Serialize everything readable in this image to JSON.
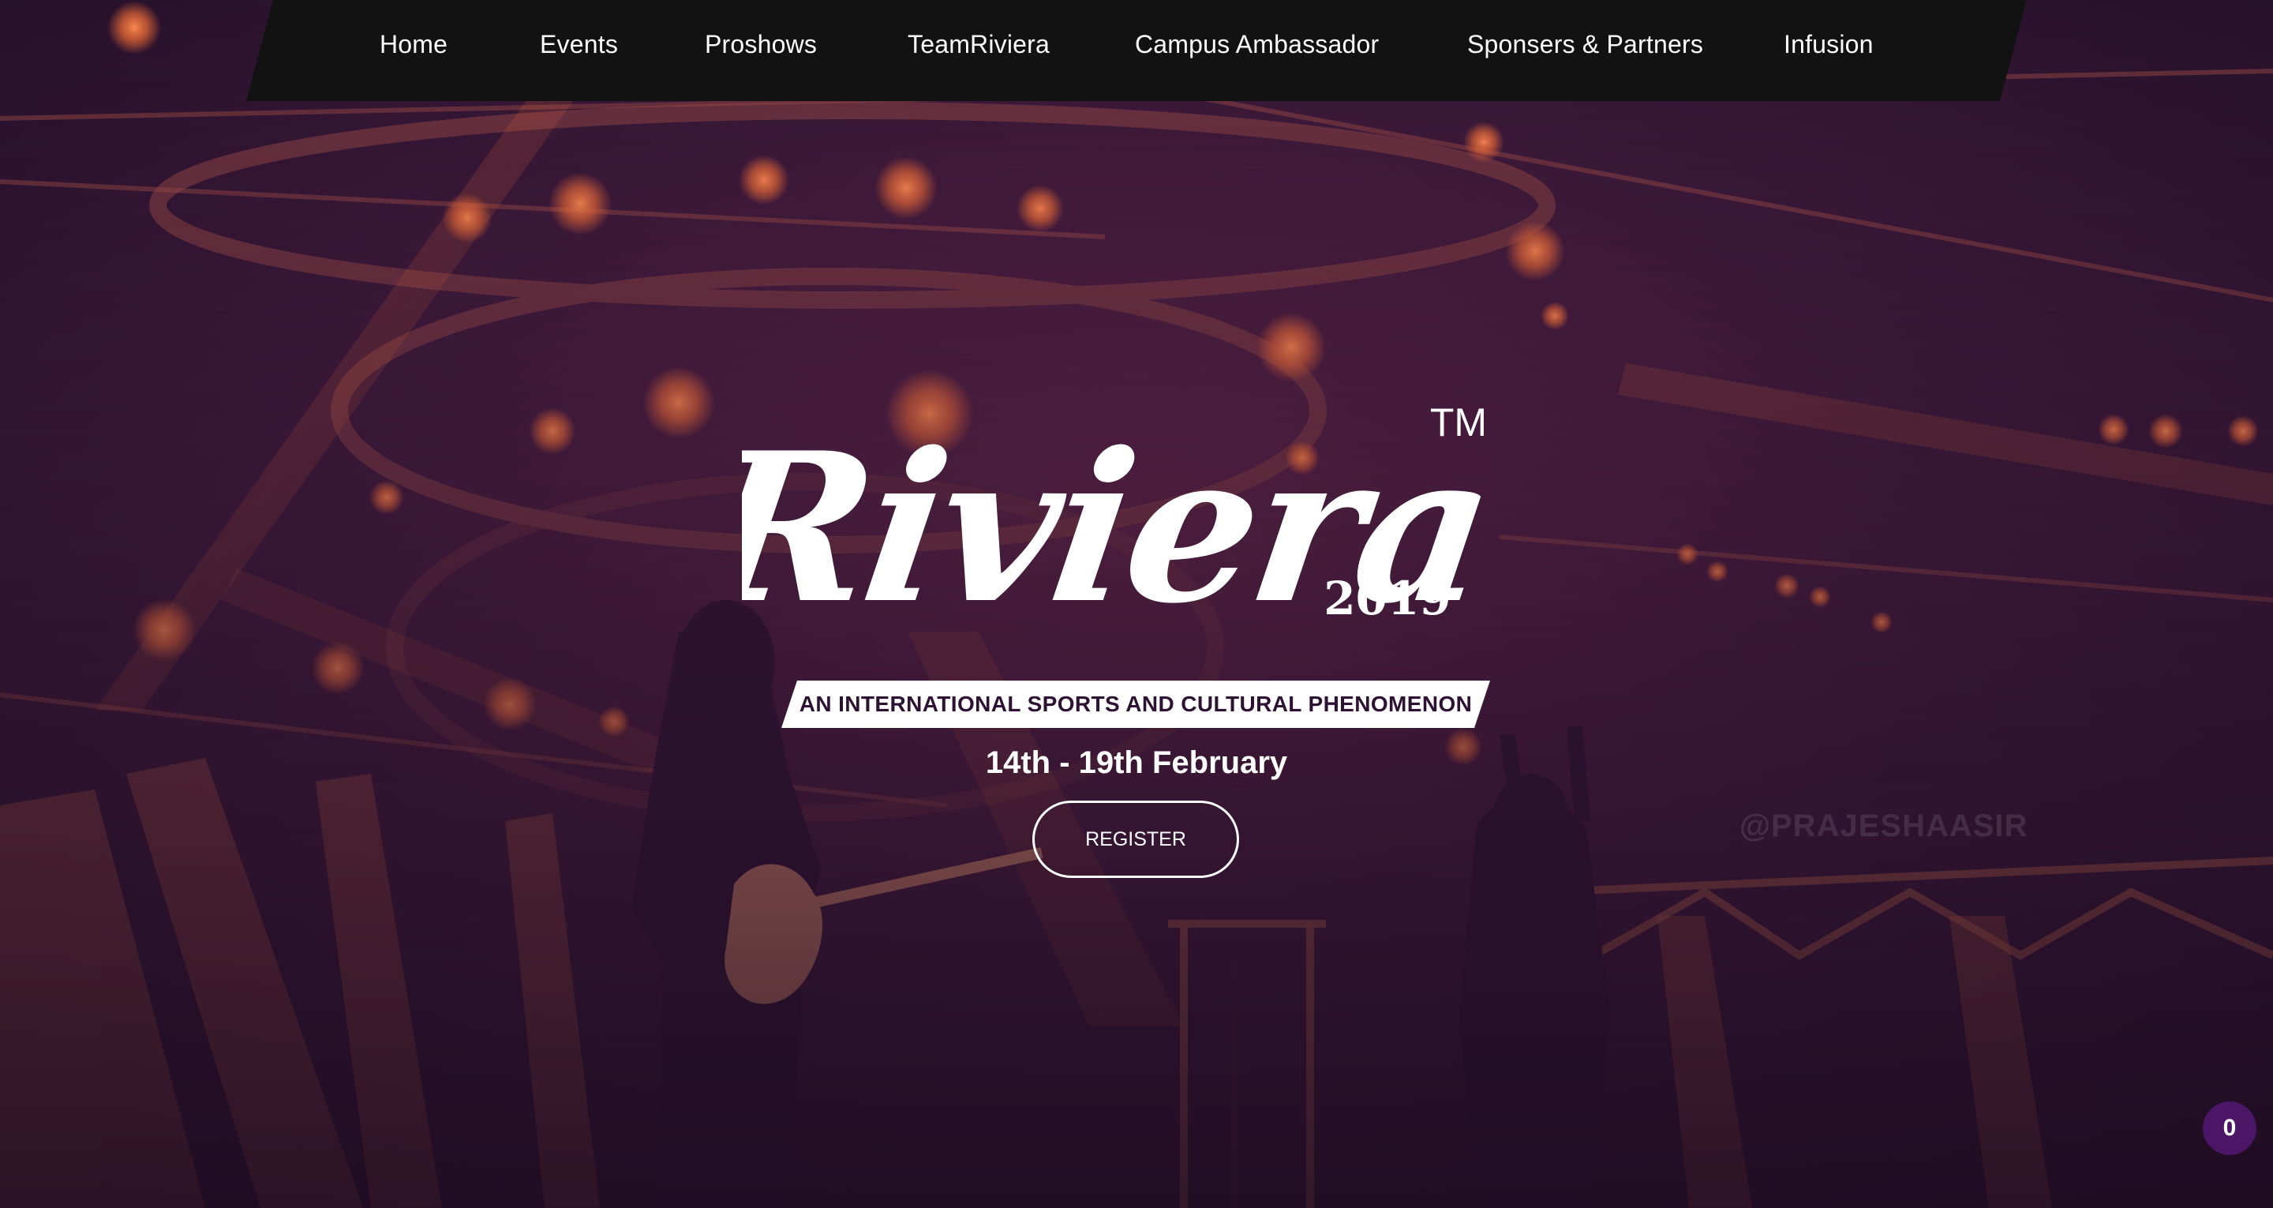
{
  "nav": {
    "items": [
      {
        "label": "Home"
      },
      {
        "label": "Events"
      },
      {
        "label": "Proshows"
      },
      {
        "label": "TeamRiviera"
      },
      {
        "label": "Campus Ambassador"
      },
      {
        "label": "Sponsers & Partners"
      },
      {
        "label": "Infusion"
      }
    ]
  },
  "hero": {
    "logo_text": "Riviera",
    "logo_trademark": "TM",
    "logo_year": "2019",
    "tagline": "AN INTERNATIONAL SPORTS AND CULTURAL PHENOMENON",
    "dates": "14th - 19th February",
    "register_label": "REGISTER",
    "photo_credit": "@PRAJESHAASIR"
  },
  "cart": {
    "count": "0"
  },
  "colors": {
    "overlay": "#3a1a40",
    "accent_orange": "#f0703a",
    "nav_bg": "#121212",
    "badge_bg": "#4b1665"
  },
  "icons": {
    "logo": "riviera-logo"
  }
}
